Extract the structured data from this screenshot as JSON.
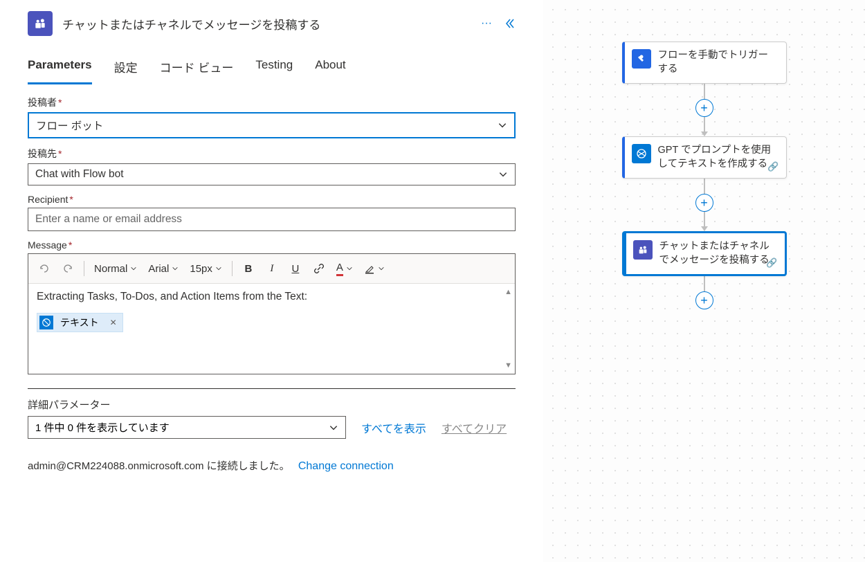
{
  "header": {
    "title": "チャットまたはチャネルでメッセージを投稿する"
  },
  "tabs": [
    "Parameters",
    "設定",
    "コード ビュー",
    "Testing",
    "About"
  ],
  "form": {
    "poster": {
      "label": "投稿者",
      "value": "フロー ボット",
      "required": true
    },
    "postTo": {
      "label": "投稿先",
      "value": "Chat with Flow bot",
      "required": true
    },
    "recipient": {
      "label": "Recipient",
      "placeholder": "Enter a name or email address",
      "required": true
    },
    "message": {
      "label": "Message",
      "required": true,
      "text": "Extracting Tasks, To-Dos, and Action Items from the Text:",
      "token": "テキスト",
      "toolbar": {
        "undo": "↶",
        "redo": "↷",
        "style": "Normal",
        "font": "Arial",
        "size": "15px",
        "bold": "B",
        "italic": "I",
        "underline": "U",
        "link": "🔗",
        "color": "A",
        "highlight": "✎"
      }
    }
  },
  "advanced": {
    "title": "詳細パラメーター",
    "display": "1 件中 0 件を表示しています",
    "showAll": "すべてを表示",
    "clearAll": "すべてクリア"
  },
  "connection": {
    "text": "admin@CRM224088.onmicrosoft.com に接続しました。",
    "change": "Change connection"
  },
  "flow": {
    "node1": "フローを手動でトリガーする",
    "node2": "GPT でプロンプトを使用してテキストを作成する",
    "node3": "チャットまたはチャネルでメッセージを投稿する"
  }
}
